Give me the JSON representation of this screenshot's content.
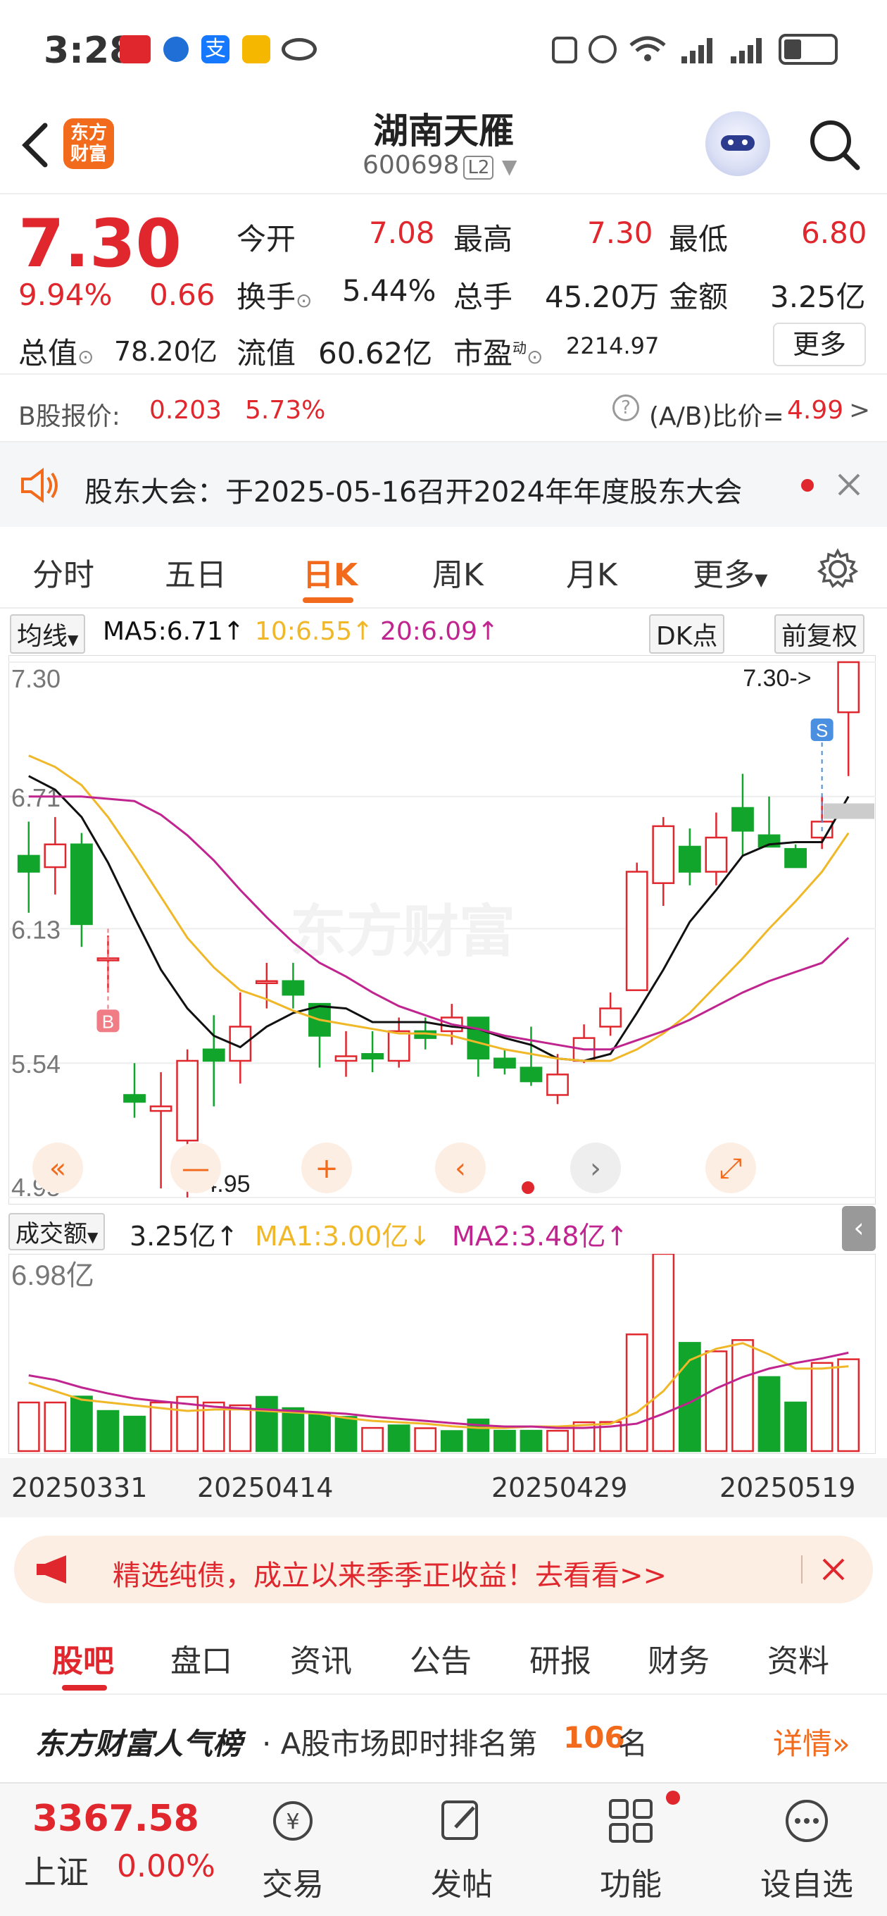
{
  "status_bar": {
    "time": "3:28"
  },
  "header": {
    "back_icon": "chevron-left-icon",
    "logo_text": "东方财富",
    "stock_name": "湖南天雁",
    "stock_code": "600698",
    "level_badge": "L2",
    "search_icon": "search-icon"
  },
  "quote": {
    "price": "7.30",
    "change_pct": "9.94%",
    "change": "0.66",
    "open_label": "今开",
    "open": "7.08",
    "high_label": "最高",
    "high": "7.30",
    "low_label": "最低",
    "low": "6.80",
    "turnover_label": "换手",
    "turnover": "5.44%",
    "volume_label": "总手",
    "volume": "45.20万",
    "amount_label": "金额",
    "amount": "3.25亿",
    "mktcap_label": "总值",
    "mktcap": "78.20亿",
    "float_label": "流值",
    "float": "60.62亿",
    "pe_label": "市盈",
    "pe_sup": "动",
    "pe": "2214.97",
    "more_button": "更多"
  },
  "bshare": {
    "label": "B股报价:",
    "price": "0.203",
    "pct": "5.73%",
    "ratio_label": "(A/B)比价=",
    "ratio": "4.99",
    "arrow": ">"
  },
  "notice": {
    "text": "股东大会：于2025-05-16召开2024年年度股东大会"
  },
  "period_tabs": [
    "分时",
    "五日",
    "日K",
    "周K",
    "月K",
    "更多"
  ],
  "active_tab": "日K",
  "ma_bar": {
    "selector": "均线",
    "ma5": "MA5:6.71↑",
    "ma10": "10:6.55↑",
    "ma20": "20:6.09↑",
    "dk_button": "DK点",
    "adjust_button": "前复权"
  },
  "colors": {
    "up": "#e0272d",
    "down": "#12a52c",
    "ma5": "#111111",
    "ma10": "#f0b828",
    "ma20": "#c0258f",
    "accent": "#f26a1b"
  },
  "chart_data": [
    {
      "type": "candlestick",
      "ylim": [
        4.95,
        7.3
      ],
      "y_ticks": [
        "7.30",
        "6.71",
        "6.13",
        "5.54",
        "4.95"
      ],
      "annotations": {
        "max": "7.30->",
        "min": "<-4.95",
        "sell_marker": "S",
        "buy_marker": "B"
      },
      "x_labels": [
        "20250331",
        "20250414",
        "20250429",
        "20250519"
      ],
      "ohlc": [
        [
          6.45,
          6.6,
          6.2,
          6.38
        ],
        [
          6.4,
          6.62,
          6.28,
          6.5
        ],
        [
          6.5,
          6.55,
          6.05,
          6.15
        ],
        [
          6.0,
          6.1,
          5.85,
          6.0
        ],
        [
          5.4,
          5.54,
          5.3,
          5.37
        ],
        [
          5.33,
          5.5,
          4.99,
          5.35
        ],
        [
          5.2,
          5.6,
          4.95,
          5.55
        ],
        [
          5.6,
          5.75,
          5.35,
          5.55
        ],
        [
          5.55,
          5.85,
          5.45,
          5.7
        ],
        [
          5.9,
          5.98,
          5.78,
          5.9
        ],
        [
          5.9,
          5.98,
          5.78,
          5.84
        ],
        [
          5.8,
          5.78,
          5.52,
          5.66
        ],
        [
          5.55,
          5.68,
          5.48,
          5.57
        ],
        [
          5.58,
          5.68,
          5.5,
          5.56
        ],
        [
          5.55,
          5.74,
          5.52,
          5.68
        ],
        [
          5.68,
          5.74,
          5.6,
          5.65
        ],
        [
          5.68,
          5.8,
          5.62,
          5.74
        ],
        [
          5.74,
          5.66,
          5.48,
          5.56
        ],
        [
          5.56,
          5.6,
          5.49,
          5.52
        ],
        [
          5.52,
          5.7,
          5.44,
          5.46
        ],
        [
          5.4,
          5.58,
          5.36,
          5.49
        ],
        [
          5.55,
          5.71,
          5.54,
          5.65
        ],
        [
          5.7,
          5.85,
          5.66,
          5.78
        ],
        [
          5.86,
          6.42,
          5.86,
          6.38
        ],
        [
          6.33,
          6.62,
          6.23,
          6.58
        ],
        [
          6.49,
          6.57,
          6.32,
          6.38
        ],
        [
          6.38,
          6.64,
          6.32,
          6.53
        ],
        [
          6.66,
          6.81,
          6.45,
          6.56
        ],
        [
          6.54,
          6.71,
          6.49,
          6.49
        ],
        [
          6.48,
          6.5,
          6.4,
          6.4
        ],
        [
          6.53,
          6.71,
          6.48,
          6.6
        ],
        [
          7.08,
          7.3,
          6.8,
          7.3
        ]
      ],
      "ma5": [
        6.8,
        6.74,
        6.62,
        6.42,
        6.18,
        5.95,
        5.78,
        5.66,
        5.61,
        5.7,
        5.76,
        5.79,
        5.78,
        5.72,
        5.72,
        5.72,
        5.7,
        5.69,
        5.65,
        5.62,
        5.56,
        5.55,
        5.58,
        5.76,
        5.95,
        6.16,
        6.3,
        6.45,
        6.5,
        6.51,
        6.51,
        6.71
      ],
      "ma10": [
        6.89,
        6.84,
        6.76,
        6.62,
        6.45,
        6.27,
        6.09,
        5.96,
        5.86,
        5.82,
        5.77,
        5.73,
        5.71,
        5.69,
        5.67,
        5.67,
        5.66,
        5.63,
        5.6,
        5.58,
        5.56,
        5.55,
        5.55,
        5.6,
        5.67,
        5.76,
        5.88,
        6.0,
        6.13,
        6.25,
        6.38,
        6.55
      ],
      "ma20": [
        6.71,
        6.71,
        6.71,
        6.7,
        6.69,
        6.63,
        6.54,
        6.43,
        6.3,
        6.18,
        6.07,
        5.98,
        5.92,
        5.85,
        5.79,
        5.75,
        5.71,
        5.69,
        5.66,
        5.64,
        5.62,
        5.6,
        5.6,
        5.64,
        5.68,
        5.73,
        5.79,
        5.85,
        5.9,
        5.94,
        5.98,
        6.09
      ]
    },
    {
      "type": "bar",
      "title": "成交额",
      "ylim": [
        0,
        6.98
      ],
      "y_ticks": [
        "6.98亿"
      ],
      "values": [
        1.72,
        1.72,
        1.93,
        1.42,
        1.22,
        1.72,
        1.92,
        1.72,
        1.62,
        1.92,
        1.52,
        1.32,
        1.21,
        0.82,
        0.91,
        0.81,
        0.71,
        1.12,
        0.72,
        0.72,
        0.72,
        1.02,
        1.03,
        4.13,
        6.98,
        3.83,
        3.53,
        3.93,
        2.62,
        1.72,
        3.12,
        3.25
      ],
      "up": [
        true,
        true,
        false,
        false,
        false,
        true,
        true,
        true,
        true,
        false,
        false,
        false,
        false,
        true,
        false,
        true,
        false,
        false,
        false,
        false,
        true,
        true,
        true,
        true,
        true,
        false,
        true,
        true,
        false,
        false,
        true,
        true
      ],
      "ma1": [
        2.42,
        2.12,
        1.82,
        1.72,
        1.62,
        1.52,
        1.42,
        1.47,
        1.48,
        1.42,
        1.37,
        1.32,
        1.17,
        1.07,
        1.02,
        0.97,
        0.88,
        0.82,
        0.82,
        0.87,
        0.87,
        0.92,
        0.97,
        1.37,
        2.12,
        3.22,
        3.62,
        3.82,
        3.42,
        2.92,
        2.92,
        3.0
      ],
      "ma2": [
        2.68,
        2.52,
        2.25,
        2.04,
        1.86,
        1.76,
        1.67,
        1.57,
        1.51,
        1.47,
        1.42,
        1.37,
        1.32,
        1.22,
        1.14,
        1.07,
        0.99,
        0.92,
        0.87,
        0.87,
        0.82,
        0.82,
        0.87,
        0.97,
        1.32,
        1.72,
        2.22,
        2.62,
        2.92,
        3.12,
        3.28,
        3.48
      ]
    }
  ],
  "vol_bar": {
    "selector": "成交额",
    "current": "3.25亿↑",
    "ma1": "MA1:3.00亿↓",
    "ma2": "MA2:3.48亿↑"
  },
  "ad_banner": {
    "text": "精选纯债，成立以来季季正收益！去看看>>"
  },
  "news_tabs": [
    "股吧",
    "盘口",
    "资讯",
    "公告",
    "研报",
    "财务",
    "资料"
  ],
  "rank": {
    "brand": "东方财富人气榜",
    "prefix": "· A股市场即时排名第",
    "number": "106",
    "suffix": "名",
    "detail": "详情"
  },
  "bottom_bar": {
    "index_value": "3367.58",
    "index_name": "上证",
    "index_pct": "0.00%",
    "items": [
      "交易",
      "发帖",
      "功能",
      "设自选"
    ]
  }
}
